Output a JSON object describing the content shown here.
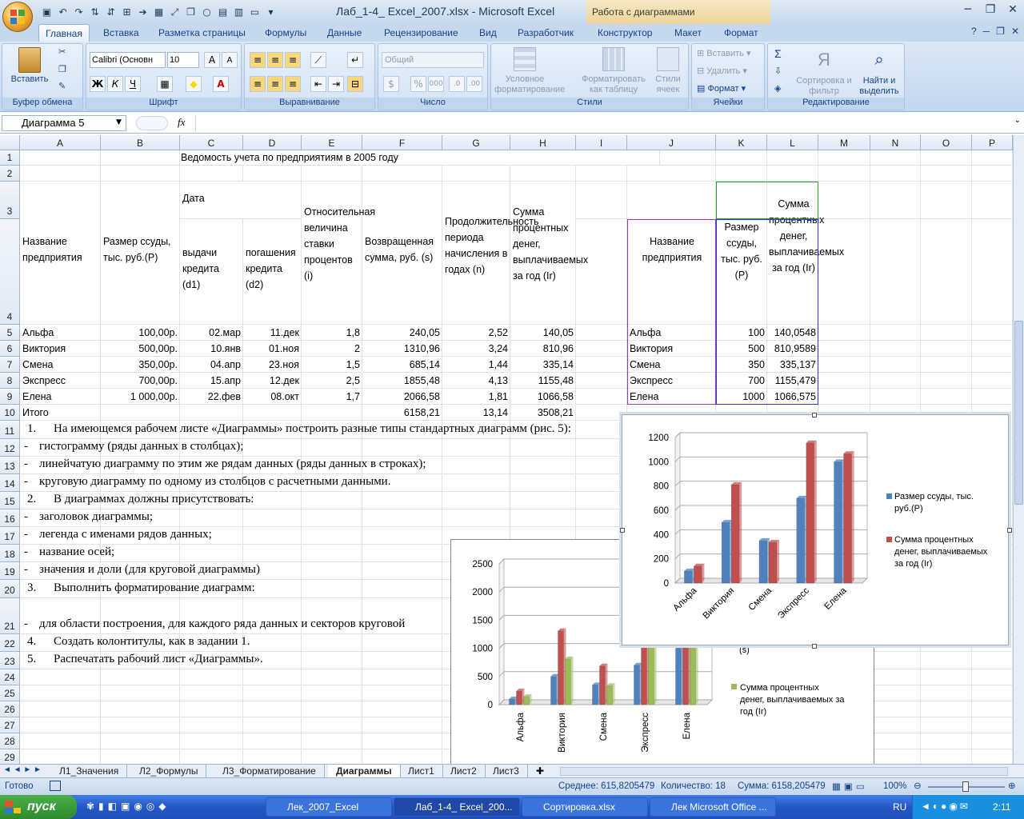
{
  "window": {
    "title": "Лаб_1-4_ Excel_2007.xlsx - Microsoft Excel",
    "context_title": "Работа с диаграммами"
  },
  "tabs": [
    "Главная",
    "Вставка",
    "Разметка страницы",
    "Формулы",
    "Данные",
    "Рецензирование",
    "Вид",
    "Разработчик",
    "Конструктор",
    "Макет",
    "Формат"
  ],
  "ribbon": {
    "paste": "Вставить",
    "clipboard": "Буфер обмена",
    "font_name": "Calibri (Основн",
    "font_size": "10",
    "font": "Шрифт",
    "alignment": "Выравнивание",
    "number_format": "Общий",
    "number": "Число",
    "cond_format": "Условное форматирование",
    "format_table": "Форматировать как таблицу",
    "cell_styles": "Стили ячеек",
    "styles": "Стили",
    "insert": "Вставить",
    "delete": "Удалить",
    "format": "Формат",
    "cells": "Ячейки",
    "sort": "Сортировка и фильтр",
    "find": "Найти и выделить",
    "editing": "Редактирование",
    "bold": "Ж",
    "italic": "К",
    "underline": "Ч"
  },
  "namebox": "Диаграмма 5",
  "columns": [
    "A",
    "B",
    "C",
    "D",
    "E",
    "F",
    "G",
    "H",
    "I",
    "J",
    "K",
    "L",
    "M",
    "N",
    "O",
    "P"
  ],
  "cells": {
    "title": "Ведомость учета по предприятиям в 2005 году",
    "date": "Дата",
    "h_name": "Название предприятия",
    "h_loan": "Размер ссуды, тыс. руб.(P)",
    "h_d1": "выдачи кредита (d1)",
    "h_d2": "погашения кредита (d2)",
    "h_rate": "Относительная величина ставки процентов (i)",
    "h_ret": "Возвращенная сумма, руб. (s)",
    "h_dur": "Продолжительность периода начисления в годах (n)",
    "h_int": "Сумма процентных денег, выплачиваемых за год (Ir)",
    "j_name": "Название предприятия",
    "k_loan": "Размер ссуды, тыс. руб.(P)",
    "l_int": "Сумма процентных денег, выплачиваемых за год (Ir)",
    "total": "Итого",
    "t_f": "6158,21",
    "t_g": "13,14",
    "t_h": "3508,21"
  },
  "rows": [
    {
      "a": "Альфа",
      "b": "100,00р.",
      "c": "02.мар",
      "d": "11.дек",
      "e": "1,8",
      "f": "240,05",
      "g": "2,52",
      "h": "140,05",
      "j": "Альфа",
      "k": "100",
      "l": "140,0548"
    },
    {
      "a": "Виктория",
      "b": "500,00р.",
      "c": "10.янв",
      "d": "01.ноя",
      "e": "2",
      "f": "1310,96",
      "g": "3,24",
      "h": "810,96",
      "j": "Виктория",
      "k": "500",
      "l": "810,9589"
    },
    {
      "a": "Смена",
      "b": "350,00р.",
      "c": "04.апр",
      "d": "23.ноя",
      "e": "1,5",
      "f": "685,14",
      "g": "1,44",
      "h": "335,14",
      "j": "Смена",
      "k": "350",
      "l": "335,137"
    },
    {
      "a": "Экспресс",
      "b": "700,00р.",
      "c": "15.апр",
      "d": "12.дек",
      "e": "2,5",
      "f": "1855,48",
      "g": "4,13",
      "h": "1155,48",
      "j": "Экспресс",
      "k": "700",
      "l": "1155,479"
    },
    {
      "a": "Елена",
      "b": "1 000,00р.",
      "c": "22.фев",
      "d": "08.окт",
      "e": "1,7",
      "f": "2066,58",
      "g": "1,81",
      "h": "1066,58",
      "j": "Елена",
      "k": "1000",
      "l": "1066,575"
    }
  ],
  "instructions": [
    {
      "num": "1.",
      "text": "На имеющемся рабочем листе «Диаграммы» построить разные типы стандартных диаграмм (рис. 5):"
    },
    {
      "num": "-",
      "text": "гистограмму (ряды данных в столбцах);"
    },
    {
      "num": "-",
      "text": "линейчатую диаграмму по этим же рядам данных (ряды данных в строках);"
    },
    {
      "num": "-",
      "text": "круговую диаграмму по одному из столбцов с расчетными данными."
    },
    {
      "num": "2.",
      "text": "В диаграммах должны присутствовать:"
    },
    {
      "num": "-",
      "text": "заголовок диаграммы;"
    },
    {
      "num": "-",
      "text": "легенда с именами рядов данных;"
    },
    {
      "num": "-",
      "text": "название осей;"
    },
    {
      "num": "-",
      "text": "значения и доли (для круговой диаграммы)"
    },
    {
      "num": "3.",
      "text": "Выполнить форматирование диаграмм:"
    },
    {
      "num": "-",
      "text": "для области построения, для каждого ряда данных  и секторов круговой"
    },
    {
      "num": "4.",
      "text": "Создать колонтитулы, как в задании 1."
    },
    {
      "num": "5.",
      "text": "Распечатать рабочий лист «Диаграммы»."
    }
  ],
  "sheets": [
    "Л1_Значения",
    "Л2_Формулы",
    "Л3_Форматирование",
    "Диаграммы",
    "Лист1",
    "Лист2",
    "Лист3"
  ],
  "status": {
    "ready": "Готово",
    "avg": "Среднее: 615,8205479",
    "count": "Количество: 18",
    "sum": "Сумма: 6158,205479",
    "zoom": "100%"
  },
  "taskbar": {
    "start": "пуск",
    "tasks": [
      "Лек_2007_Excel",
      "Лаб_1-4_ Excel_200...",
      "Сортировка.xlsx",
      "Лек Microsoft Office ..."
    ],
    "lang": "RU",
    "clock": "2:11"
  },
  "colors": {
    "blue": "#4f81bd",
    "red": "#c0504d",
    "green": "#9bbb59"
  },
  "chart_data": [
    {
      "type": "bar",
      "categories": [
        "Альфа",
        "Виктория",
        "Смена",
        "Экспресс",
        "Елена"
      ],
      "series": [
        {
          "name": "Размер ссуды, тыс. руб.(P)",
          "values": [
            100,
            500,
            350,
            700,
            1000
          ]
        },
        {
          "name": "Сумма процентных денег, выплачиваемых за год (Ir)",
          "values": [
            140.05,
            810.96,
            335.14,
            1155.48,
            1066.58
          ]
        }
      ],
      "ylim": [
        0,
        1200
      ],
      "yticks": [
        0,
        200,
        400,
        600,
        800,
        1000,
        1200
      ],
      "legend": "right"
    },
    {
      "type": "bar",
      "categories": [
        "Альфа",
        "Виктория",
        "Смена",
        "Экспресс",
        "Елена"
      ],
      "series": [
        {
          "name": "Размер ссуды, тыс. руб.(P)",
          "values": [
            100,
            500,
            350,
            700,
            1000
          ]
        },
        {
          "name": "Возвращенная сумма, руб. (s)",
          "values": [
            240.05,
            1310.96,
            685.14,
            1855.48,
            2066.58
          ]
        },
        {
          "name": "Сумма процентных денег, выплачиваемых за год (Ir)",
          "values": [
            140.05,
            810.96,
            335.14,
            1155.48,
            1066.58
          ]
        }
      ],
      "ylim": [
        0,
        2500
      ],
      "yticks": [
        0,
        500,
        1000,
        1500,
        2000,
        2500
      ],
      "legend": "right",
      "legend_visible": [
        "(s)",
        "Сумма процентных денег, выплачиваемых за год (Ir)"
      ]
    }
  ]
}
